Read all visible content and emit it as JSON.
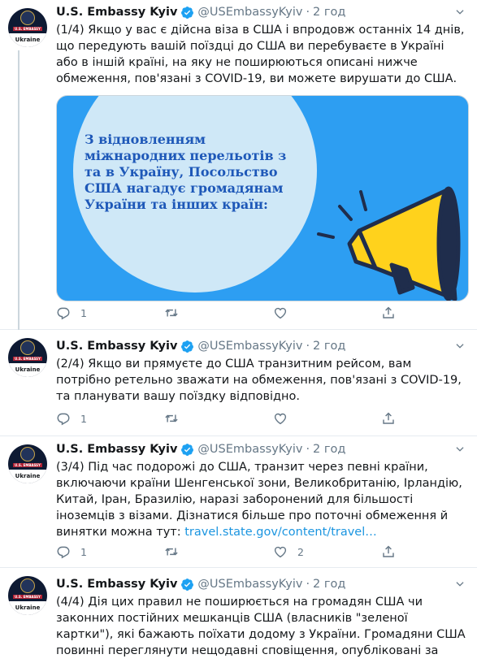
{
  "colors": {
    "link": "#1b95e0",
    "secondary_text": "#657786",
    "verified": "#1da1f2",
    "divider": "#e6ecf0",
    "media_bg": "#2d9ef2",
    "megaphone_yellow": "#ffd21c",
    "megaphone_dark": "#1f2d4c"
  },
  "icons": {
    "verified": "verified-badge-icon",
    "more": "chevron-down-icon",
    "reply": "reply-icon",
    "retweet": "retweet-icon",
    "like": "heart-icon",
    "share": "share-icon"
  },
  "tweets": [
    {
      "avatar": {
        "band_text": "U.S. EMBASSY",
        "country": "Ukraine"
      },
      "name": "U.S. Embassy Kyiv",
      "handle": "@USEmbassyKyiv",
      "separator": "·",
      "time": "2 год",
      "text": "(1/4) Якщо у вас є дійсна віза в США і впродовж останніх 14 днів, що передують вашій поїздці до США ви перебуваєте в Україні або в іншій країні, на яку не поширюються описані нижче обмеження, пов'язані з COVID-19, ви можете вирушати до США.",
      "media_text": "З відновленням міжнародних перельотів з та в Україну, Посольство США нагадує громадянам України та інших країн:",
      "reply_count": "1",
      "retweet_count": "",
      "like_count": ""
    },
    {
      "avatar": {
        "band_text": "U.S. EMBASSY",
        "country": "Ukraine"
      },
      "name": "U.S. Embassy Kyiv",
      "handle": "@USEmbassyKyiv",
      "separator": "·",
      "time": "2 год",
      "text": "(2/4) Якщо ви прямуєте до США транзитним рейсом, вам потрібно ретельно зважати на обмеження, пов'язані з COVID-19, та планувати вашу поїздку відповідно.",
      "reply_count": "1",
      "retweet_count": "",
      "like_count": ""
    },
    {
      "avatar": {
        "band_text": "U.S. EMBASSY",
        "country": "Ukraine"
      },
      "name": "U.S. Embassy Kyiv",
      "handle": "@USEmbassyKyiv",
      "separator": "·",
      "time": "2 год",
      "text": "(3/4) Під час подорожі до США, транзит через певні країни, включаючи країни Шенгенської зони, Великобританію, Ірландію, Китай, Іран, Бразилію, наразі заборонений для більшості іноземців з візами. Дізнатися більше про поточні обмеження й винятки можна тут:",
      "link": "travel.state.gov/content/travel…",
      "reply_count": "1",
      "retweet_count": "",
      "like_count": "2"
    },
    {
      "avatar": {
        "band_text": "U.S. EMBASSY",
        "country": "Ukraine"
      },
      "name": "U.S. Embassy Kyiv",
      "handle": "@USEmbassyKyiv",
      "separator": "·",
      "time": "2 год",
      "text": "(4/4) Дія цих правил не поширюється на громадян США чи законних постійних мешканців США (власників \"зеленої картки\"), які бажають поїхати додому з України. Громадяни США повинні переглянути нещодавні сповіщення, опубліковані за посиланням:"
    }
  ]
}
